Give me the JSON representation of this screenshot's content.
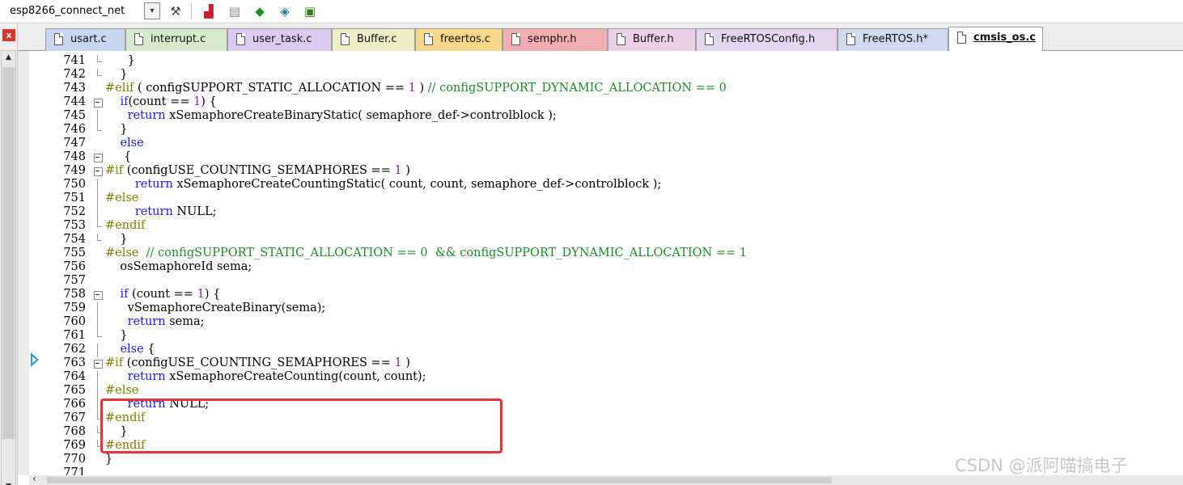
{
  "toolbar": {
    "target": "esp8266_connect_net",
    "target_arrow": "▾",
    "icons": [
      "chevron-down-icon",
      "magic-wand-icon",
      "manage-components-icon",
      "window-layout-icon",
      "green-diamond-icon",
      "pack-installer-icon",
      "package-icon"
    ]
  },
  "left_panel": {
    "close_glyph": "x",
    "up_glyph": "▲",
    "down_glyph": "▼"
  },
  "tabs": [
    {
      "label": "usart.c",
      "color": "#c9d6f2"
    },
    {
      "label": "interrupt.c",
      "color": "#d7ebcc"
    },
    {
      "label": "user_task.c",
      "color": "#dccaf0"
    },
    {
      "label": "Buffer.c",
      "color": "#eeeec6"
    },
    {
      "label": "freertos.c",
      "color": "#f7d78a"
    },
    {
      "label": "semphr.h",
      "color": "#f0aeb0"
    },
    {
      "label": "Buffer.h",
      "color": "#ecd0e7"
    },
    {
      "label": "FreeRTOSConfig.h",
      "color": "#e3d6ee"
    },
    {
      "label": "FreeRTOS.h*",
      "color": "#cfd9f0"
    },
    {
      "label": "cmsis_os.c",
      "color": "#ffffff",
      "active": true
    }
  ],
  "code": [
    {
      "n": "741",
      "fold": "end",
      "html": "      }"
    },
    {
      "n": "742",
      "fold": "end",
      "html": "    }"
    },
    {
      "n": "743",
      "fold": "none",
      "html": "<span class=\"pp\">#elif</span> ( configSUPPORT_STATIC_ALLOCATION == <span class=\"num\">1</span> ) <span class=\"cm\">// configSUPPORT_DYNAMIC_ALLOCATION == 0</span>"
    },
    {
      "n": "744",
      "fold": "box",
      "html": "    <span class=\"kw\">if</span>(count == <span class=\"num\">1</span>) {"
    },
    {
      "n": "745",
      "fold": "mid",
      "html": "      <span class=\"kw\">return</span> xSemaphoreCreateBinaryStatic( semaphore_def-&gt;controlblock );"
    },
    {
      "n": "746",
      "fold": "end",
      "html": "    }"
    },
    {
      "n": "747",
      "fold": "none",
      "html": "    <span class=\"kw\">else</span>"
    },
    {
      "n": "748",
      "fold": "box",
      "html": "     {"
    },
    {
      "n": "749",
      "fold": "box",
      "html": "<span class=\"pp\">#if</span> (configUSE_COUNTING_SEMAPHORES == <span class=\"num\">1</span> )"
    },
    {
      "n": "750",
      "fold": "mid",
      "html": "        <span class=\"kw\">return</span> xSemaphoreCreateCountingStatic( count, count, semaphore_def-&gt;controlblock );"
    },
    {
      "n": "751",
      "fold": "mid",
      "html": "<span class=\"pp\">#else</span>"
    },
    {
      "n": "752",
      "fold": "mid",
      "html": "        <span class=\"kw\">return</span> NULL;"
    },
    {
      "n": "753",
      "fold": "end",
      "html": "<span class=\"pp\">#endif</span>"
    },
    {
      "n": "754",
      "fold": "end",
      "html": "    }"
    },
    {
      "n": "755",
      "fold": "none",
      "html": "<span class=\"pp\">#else</span>  <span class=\"cm\">// configSUPPORT_STATIC_ALLOCATION == 0  &amp;&amp; configSUPPORT_DYNAMIC_ALLOCATION == 1</span>"
    },
    {
      "n": "756",
      "fold": "none",
      "html": "    osSemaphoreId sema;"
    },
    {
      "n": "757",
      "fold": "none",
      "html": ""
    },
    {
      "n": "758",
      "fold": "box",
      "html": "    <span class=\"kw\">if</span> (count == <span class=\"num\">1</span>) {"
    },
    {
      "n": "759",
      "fold": "mid",
      "html": "      vSemaphoreCreateBinary(sema);"
    },
    {
      "n": "760",
      "fold": "mid",
      "html": "      <span class=\"kw\">return</span> sema;"
    },
    {
      "n": "761",
      "fold": "end",
      "html": "    }"
    },
    {
      "n": "762",
      "fold": "mid",
      "html": "    <span class=\"kw\">else</span> {"
    },
    {
      "n": "763",
      "fold": "box",
      "html": "<span class=\"pp\">#if</span> (configUSE_COUNTING_SEMAPHORES == <span class=\"num\">1</span> )"
    },
    {
      "n": "764",
      "fold": "mid",
      "html": "      <span class=\"kw\">return</span> xSemaphoreCreateCounting(count, count);"
    },
    {
      "n": "765",
      "fold": "mid",
      "html": "<span class=\"pp\">#else</span>"
    },
    {
      "n": "766",
      "fold": "mid",
      "html": "      <span class=\"kw\">return</span> NULL;"
    },
    {
      "n": "767",
      "fold": "end",
      "html": "<span class=\"pp\">#endif</span>"
    },
    {
      "n": "768",
      "fold": "end",
      "html": "    }"
    },
    {
      "n": "769",
      "fold": "end",
      "html": "<span class=\"pp\">#endif</span>"
    },
    {
      "n": "770",
      "fold": "none",
      "html": "}"
    },
    {
      "n": "771",
      "fold": "none",
      "html": ""
    }
  ],
  "colors": {
    "highlight_border": "#e8323c",
    "keyword": "#1a1aff",
    "preprocessor": "#7f7f00",
    "comment": "#1d8a2a",
    "number": "#9b19c2",
    "exec_marker": "#2e9bd5"
  },
  "watermark": "CSDN @派阿喵搞电子",
  "hscroll": {
    "left_glyph": "‹"
  }
}
